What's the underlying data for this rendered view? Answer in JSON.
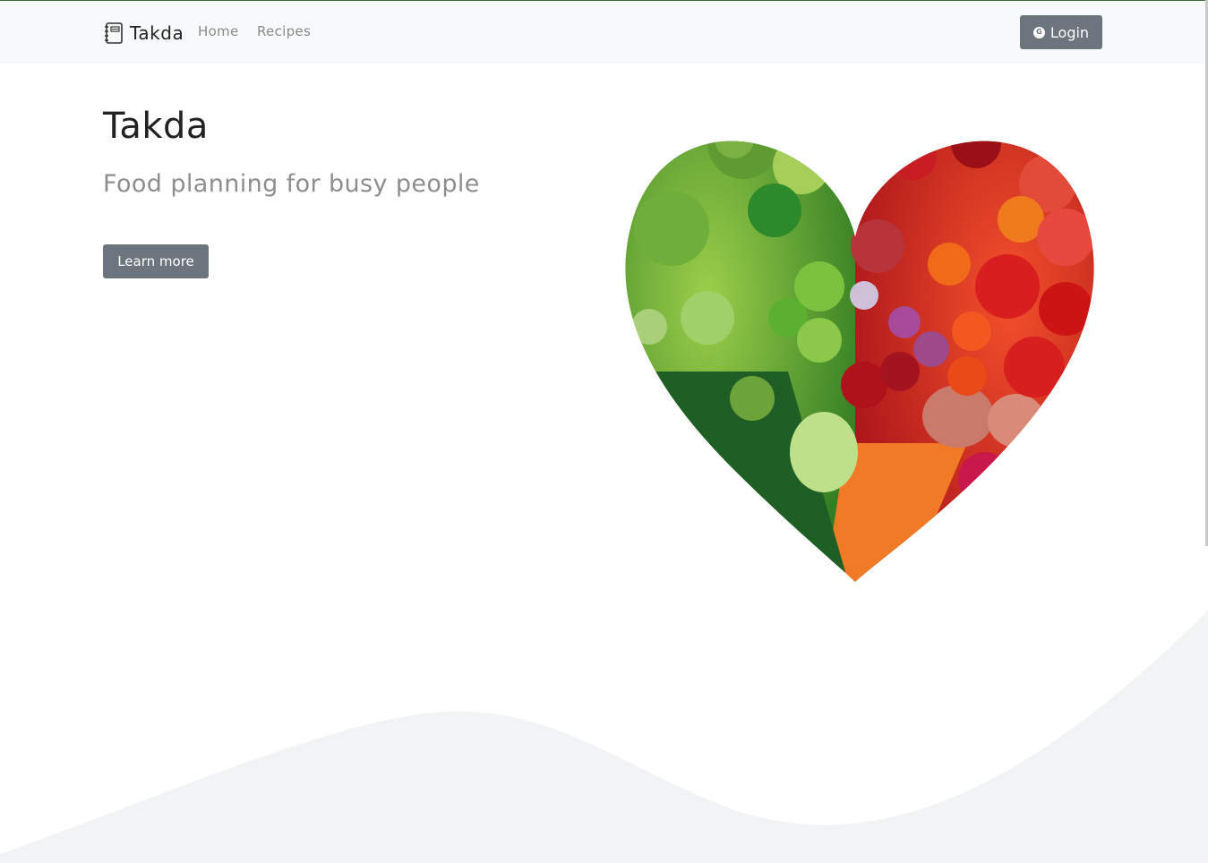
{
  "navbar": {
    "brand": "Takda",
    "links": [
      "Home",
      "Recipes"
    ],
    "login_label": "Login",
    "login_icon": "google-icon"
  },
  "hero": {
    "title": "Takda",
    "subtitle": "Food planning for busy people",
    "button_label": "Learn more"
  },
  "colors": {
    "navbar_bg": "#f8f9fa",
    "button_bg": "#6c757d",
    "wave_bg": "#f2f3f5",
    "top_accent": "#3f6b3a"
  }
}
